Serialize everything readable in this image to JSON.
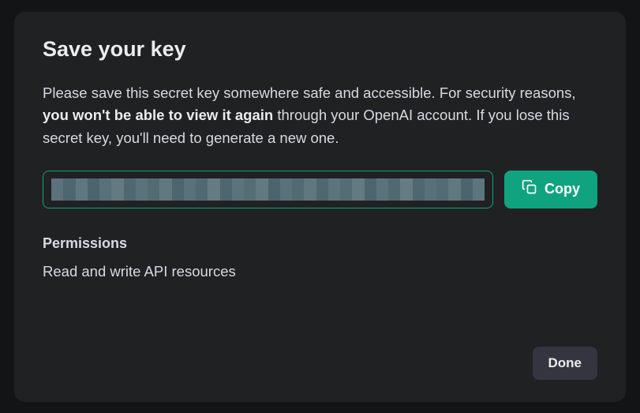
{
  "dialog": {
    "title": "Save your key",
    "description_pre": "Please save this secret key somewhere safe and accessible. For security reasons, ",
    "description_bold": "you won't be able to view it again",
    "description_post": " through your OpenAI account. If you lose this secret key, you'll need to generate a new one.",
    "copy_label": "Copy",
    "permissions_heading": "Permissions",
    "permissions_value": "Read and write API resources",
    "done_label": "Done",
    "accent_color": "#10a37f"
  }
}
